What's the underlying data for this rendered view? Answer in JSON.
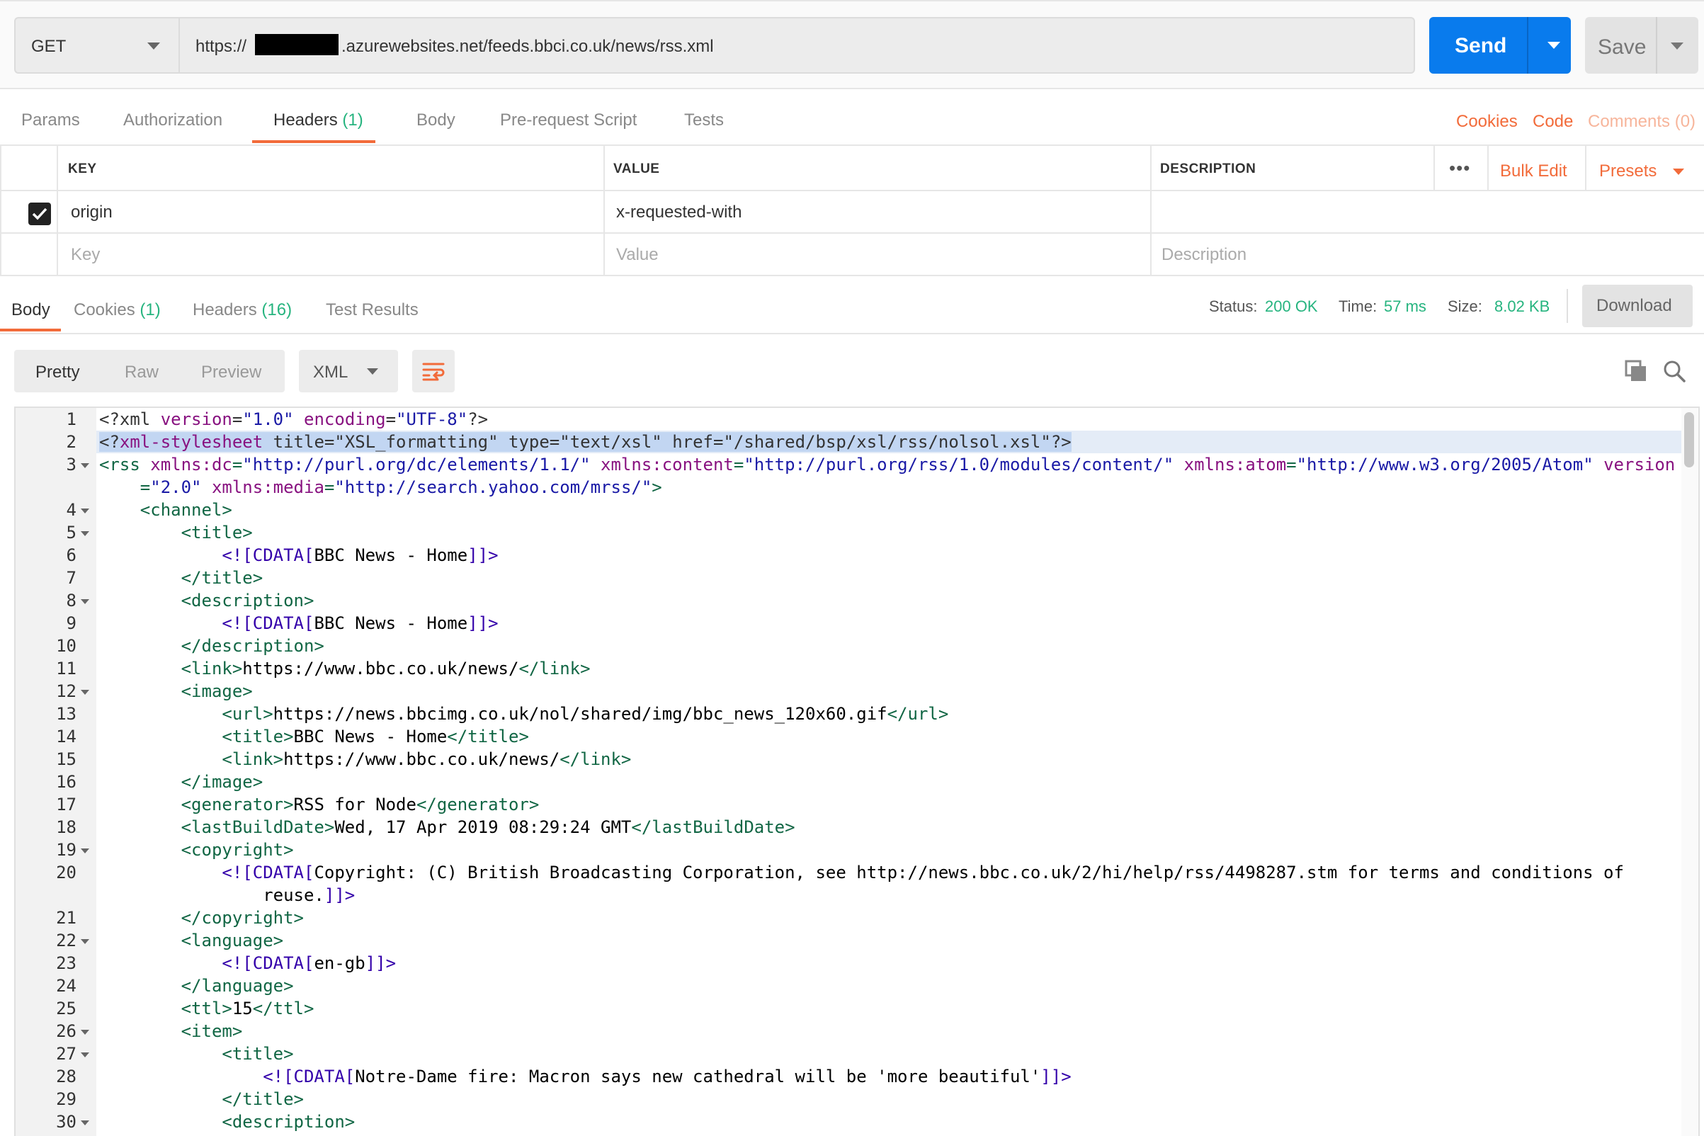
{
  "request": {
    "method": "GET",
    "url_prefix": "https://",
    "url_suffix": ".azurewebsites.net/feeds.bbci.co.uk/news/rss.xml",
    "send_label": "Send",
    "save_label": "Save"
  },
  "request_tabs": [
    {
      "label": "Params"
    },
    {
      "label": "Authorization"
    },
    {
      "label": "Headers",
      "count": "(1)"
    },
    {
      "label": "Body"
    },
    {
      "label": "Pre-request Script"
    },
    {
      "label": "Tests"
    }
  ],
  "request_links": {
    "cookies": "Cookies",
    "code": "Code",
    "comments": "Comments (0)"
  },
  "headers_table": {
    "columns": [
      "KEY",
      "VALUE",
      "DESCRIPTION"
    ],
    "bulk_edit": "Bulk Edit",
    "presets": "Presets",
    "rows": [
      {
        "checked": true,
        "key": "origin",
        "value": "x-requested-with",
        "description": ""
      }
    ],
    "placeholders": {
      "key": "Key",
      "value": "Value",
      "description": "Description"
    }
  },
  "response_tabs": [
    {
      "label": "Body"
    },
    {
      "label": "Cookies",
      "count": "(1)"
    },
    {
      "label": "Headers",
      "count": "(16)"
    },
    {
      "label": "Test Results"
    }
  ],
  "response_status": {
    "status_label": "Status:",
    "status_value": "200 OK",
    "time_label": "Time:",
    "time_value": "57 ms",
    "size_label": "Size:",
    "size_value": "8.02 KB",
    "download_label": "Download"
  },
  "body_view": {
    "modes": [
      "Pretty",
      "Raw",
      "Preview"
    ],
    "active_mode": "Pretty",
    "language": "XML"
  },
  "code_lines": [
    {
      "n": "1",
      "fold": false,
      "seg": [
        [
          "pi",
          "<?xml "
        ],
        [
          "attr",
          "version"
        ],
        [
          "pi",
          "="
        ],
        [
          "str",
          "\"1.0\""
        ],
        [
          "pi",
          " "
        ],
        [
          "attr",
          "encoding"
        ],
        [
          "pi",
          "="
        ],
        [
          "str",
          "\"UTF-8\""
        ],
        [
          "pi",
          "?>"
        ]
      ]
    },
    {
      "n": "2",
      "fold": false,
      "seg": [
        [
          "pi",
          "<?"
        ],
        [
          "attr",
          "xml-stylesheet"
        ],
        [
          "pi",
          " title="
        ],
        [
          "pi",
          "\"XSL_formatting\""
        ],
        [
          "pi",
          " type="
        ],
        [
          "pi",
          "\"text/xsl\""
        ],
        [
          "pi",
          " href="
        ],
        [
          "pi",
          "\"/shared/bsp/xsl/rss/nolsol.xsl\""
        ],
        [
          "pi",
          "?>"
        ]
      ]
    },
    {
      "n": "3",
      "fold": true,
      "seg": [
        [
          "tag",
          "<rss "
        ],
        [
          "attr",
          "xmlns:dc"
        ],
        [
          "tag",
          "="
        ],
        [
          "str",
          "\"http://purl.org/dc/elements/1.1/\""
        ],
        [
          "tag",
          " "
        ],
        [
          "attr",
          "xmlns:content"
        ],
        [
          "tag",
          "="
        ],
        [
          "str",
          "\"http://purl.org/rss/1.0/modules/content/\""
        ],
        [
          "tag",
          " "
        ],
        [
          "attr",
          "xmlns:atom"
        ],
        [
          "tag",
          "="
        ],
        [
          "str",
          "\"http://www.w3.org/2005/Atom\""
        ],
        [
          "tag",
          " "
        ],
        [
          "attr",
          "version"
        ]
      ]
    },
    {
      "n": "",
      "fold": false,
      "indent": "    ",
      "seg": [
        [
          "tag",
          "="
        ],
        [
          "str",
          "\"2.0\""
        ],
        [
          "tag",
          " "
        ],
        [
          "attr",
          "xmlns:media"
        ],
        [
          "tag",
          "="
        ],
        [
          "str",
          "\"http://search.yahoo.com/mrss/\""
        ],
        [
          "tag",
          ">"
        ]
      ]
    },
    {
      "n": "4",
      "fold": true,
      "indent": "    ",
      "seg": [
        [
          "tag",
          "<channel>"
        ]
      ]
    },
    {
      "n": "5",
      "fold": true,
      "indent": "        ",
      "seg": [
        [
          "tag",
          "<title>"
        ]
      ]
    },
    {
      "n": "6",
      "fold": false,
      "indent": "            ",
      "seg": [
        [
          "cd",
          "<![CDATA["
        ],
        [
          "txt",
          "BBC News - Home"
        ],
        [
          "cd",
          "]]>"
        ]
      ]
    },
    {
      "n": "7",
      "fold": false,
      "indent": "        ",
      "seg": [
        [
          "tag",
          "</title>"
        ]
      ]
    },
    {
      "n": "8",
      "fold": true,
      "indent": "        ",
      "seg": [
        [
          "tag",
          "<description>"
        ]
      ]
    },
    {
      "n": "9",
      "fold": false,
      "indent": "            ",
      "seg": [
        [
          "cd",
          "<![CDATA["
        ],
        [
          "txt",
          "BBC News - Home"
        ],
        [
          "cd",
          "]]>"
        ]
      ]
    },
    {
      "n": "10",
      "fold": false,
      "indent": "        ",
      "seg": [
        [
          "tag",
          "</description>"
        ]
      ]
    },
    {
      "n": "11",
      "fold": false,
      "indent": "        ",
      "seg": [
        [
          "tag",
          "<link>"
        ],
        [
          "txt",
          "https://www.bbc.co.uk/news/"
        ],
        [
          "tag",
          "</link>"
        ]
      ]
    },
    {
      "n": "12",
      "fold": true,
      "indent": "        ",
      "seg": [
        [
          "tag",
          "<image>"
        ]
      ]
    },
    {
      "n": "13",
      "fold": false,
      "indent": "            ",
      "seg": [
        [
          "tag",
          "<url>"
        ],
        [
          "txt",
          "https://news.bbcimg.co.uk/nol/shared/img/bbc_news_120x60.gif"
        ],
        [
          "tag",
          "</url>"
        ]
      ]
    },
    {
      "n": "14",
      "fold": false,
      "indent": "            ",
      "seg": [
        [
          "tag",
          "<title>"
        ],
        [
          "txt",
          "BBC News - Home"
        ],
        [
          "tag",
          "</title>"
        ]
      ]
    },
    {
      "n": "15",
      "fold": false,
      "indent": "            ",
      "seg": [
        [
          "tag",
          "<link>"
        ],
        [
          "txt",
          "https://www.bbc.co.uk/news/"
        ],
        [
          "tag",
          "</link>"
        ]
      ]
    },
    {
      "n": "16",
      "fold": false,
      "indent": "        ",
      "seg": [
        [
          "tag",
          "</image>"
        ]
      ]
    },
    {
      "n": "17",
      "fold": false,
      "indent": "        ",
      "seg": [
        [
          "tag",
          "<generator>"
        ],
        [
          "txt",
          "RSS for Node"
        ],
        [
          "tag",
          "</generator>"
        ]
      ]
    },
    {
      "n": "18",
      "fold": false,
      "indent": "        ",
      "seg": [
        [
          "tag",
          "<lastBuildDate>"
        ],
        [
          "txt",
          "Wed, 17 Apr 2019 08:29:24 GMT"
        ],
        [
          "tag",
          "</lastBuildDate>"
        ]
      ]
    },
    {
      "n": "19",
      "fold": true,
      "indent": "        ",
      "seg": [
        [
          "tag",
          "<copyright>"
        ]
      ]
    },
    {
      "n": "20",
      "fold": false,
      "indent": "            ",
      "seg": [
        [
          "cd",
          "<![CDATA["
        ],
        [
          "txt",
          "Copyright: (C) British Broadcasting Corporation, see http://news.bbc.co.uk/2/hi/help/rss/4498287.stm for terms and conditions of"
        ]
      ]
    },
    {
      "n": "",
      "fold": false,
      "indent": "                ",
      "seg": [
        [
          "txt",
          "reuse."
        ],
        [
          "cd",
          "]]>"
        ]
      ]
    },
    {
      "n": "21",
      "fold": false,
      "indent": "        ",
      "seg": [
        [
          "tag",
          "</copyright>"
        ]
      ]
    },
    {
      "n": "22",
      "fold": true,
      "indent": "        ",
      "seg": [
        [
          "tag",
          "<language>"
        ]
      ]
    },
    {
      "n": "23",
      "fold": false,
      "indent": "            ",
      "seg": [
        [
          "cd",
          "<![CDATA["
        ],
        [
          "txt",
          "en-gb"
        ],
        [
          "cd",
          "]]>"
        ]
      ]
    },
    {
      "n": "24",
      "fold": false,
      "indent": "        ",
      "seg": [
        [
          "tag",
          "</language>"
        ]
      ]
    },
    {
      "n": "25",
      "fold": false,
      "indent": "        ",
      "seg": [
        [
          "tag",
          "<ttl>"
        ],
        [
          "txt",
          "15"
        ],
        [
          "tag",
          "</ttl>"
        ]
      ]
    },
    {
      "n": "26",
      "fold": true,
      "indent": "        ",
      "seg": [
        [
          "tag",
          "<item>"
        ]
      ]
    },
    {
      "n": "27",
      "fold": true,
      "indent": "            ",
      "seg": [
        [
          "tag",
          "<title>"
        ]
      ]
    },
    {
      "n": "28",
      "fold": false,
      "indent": "                ",
      "seg": [
        [
          "cd",
          "<![CDATA["
        ],
        [
          "txt",
          "Notre-Dame fire: Macron says new cathedral will be 'more beautiful'"
        ],
        [
          "cd",
          "]]>"
        ]
      ]
    },
    {
      "n": "29",
      "fold": false,
      "indent": "            ",
      "seg": [
        [
          "tag",
          "</title>"
        ]
      ]
    },
    {
      "n": "30",
      "fold": true,
      "indent": "            ",
      "seg": [
        [
          "tag",
          "<description>"
        ]
      ]
    }
  ],
  "highlighted_line": "2",
  "icons": {
    "copy": "copy-icon",
    "search": "search-icon",
    "wrap": "wrap-lines-icon",
    "checkbox": "checkbox-checked-icon"
  },
  "colors": {
    "accent": "#f26b3a",
    "send": "#097bed",
    "success": "#26b47f"
  }
}
